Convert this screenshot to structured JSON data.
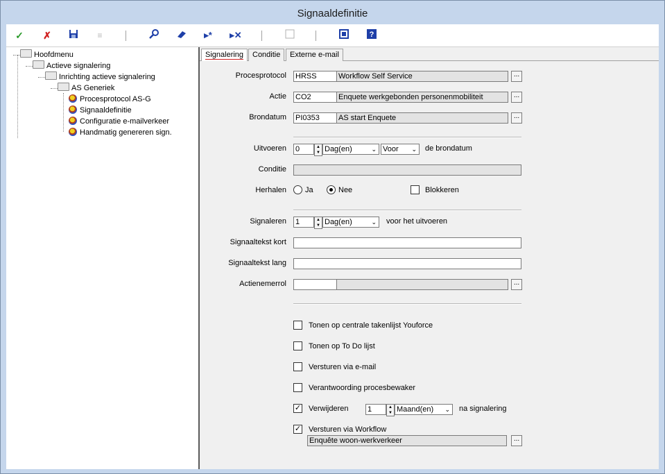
{
  "window": {
    "title": "Signaaldefinitie"
  },
  "tree": {
    "items": [
      {
        "label": "Hoofdmenu"
      },
      {
        "label": "Actieve signalering"
      },
      {
        "label": "Inrichting actieve signalering"
      },
      {
        "label": "AS Generiek"
      },
      {
        "label": "Procesprotocol AS-G"
      },
      {
        "label": "Signaaldefinitie"
      },
      {
        "label": "Configuratie e-mailverkeer"
      },
      {
        "label": "Handmatig genereren sign."
      }
    ]
  },
  "tabs": [
    {
      "label": "Signalering"
    },
    {
      "label": "Conditie"
    },
    {
      "label": "Externe e-mail"
    }
  ],
  "form": {
    "procesprotocol": {
      "label": "Procesprotocol",
      "code": "HRSS",
      "desc": "Workflow Self Service"
    },
    "actie": {
      "label": "Actie",
      "code": "CO2",
      "desc": "Enquete werkgebonden personenmobiliteit"
    },
    "brondatum": {
      "label": "Brondatum",
      "code": "PI0353",
      "desc": "AS start Enquete"
    },
    "uitvoeren": {
      "label": "Uitvoeren",
      "value": "0",
      "unit": "Dag(en)",
      "when": "Voor",
      "suffix": "de brondatum"
    },
    "conditie": {
      "label": "Conditie",
      "value": ""
    },
    "herhalen": {
      "label": "Herhalen",
      "ja": "Ja",
      "nee": "Nee",
      "blokkeren": "Blokkeren"
    },
    "signaleren": {
      "label": "Signaleren",
      "value": "1",
      "unit": "Dag(en)",
      "suffix": "voor het uitvoeren"
    },
    "kort": {
      "label": "Signaaltekst kort",
      "value": ""
    },
    "lang": {
      "label": "Signaaltekst lang",
      "value": ""
    },
    "actienemer": {
      "label": "Actienemerrol",
      "code": "",
      "desc": ""
    },
    "options": {
      "tonen_takenlijst": "Tonen op centrale takenlijst Youforce",
      "tonen_todo": "Tonen op To Do lijst",
      "versturen_email": "Versturen via e-mail",
      "verantwoording": "Verantwoording procesbewaker",
      "verwijderen": "Verwijderen",
      "verwijderen_value": "1",
      "verwijderen_unit": "Maand(en)",
      "verwijderen_suffix": "na signalering",
      "workflow": "Versturen via Workflow",
      "workflow_value": "Enquête woon-werkverkeer"
    }
  },
  "colors": {
    "titlebar": "#c5d6ec",
    "accept": "#2a9a2a",
    "cancel": "#d02020",
    "tool": "#1e3fa8"
  }
}
